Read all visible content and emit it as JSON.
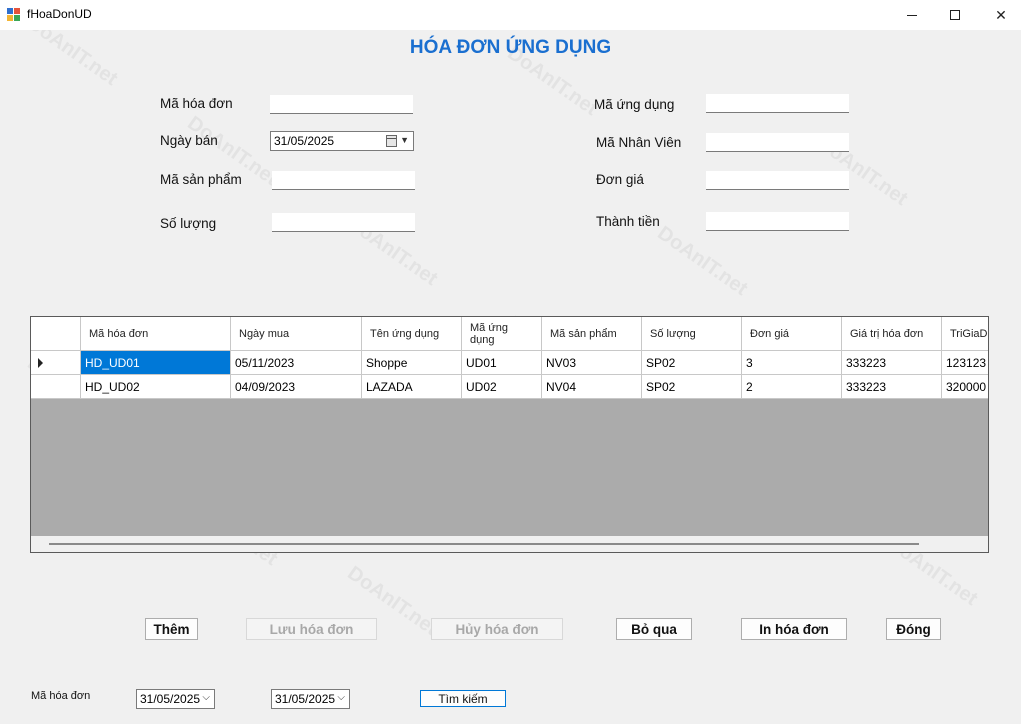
{
  "window": {
    "title": "fHoaDonUD"
  },
  "form": {
    "title": "HÓA ĐƠN ỨNG DỤNG",
    "fields": {
      "ma_hoa_don": {
        "label": "Mã hóa đơn",
        "value": ""
      },
      "ngay_ban": {
        "label": "Ngày bán",
        "value": "31/05/2025"
      },
      "ma_san_pham": {
        "label": "Mã sản phẩm",
        "value": ""
      },
      "so_luong": {
        "label": "Số lượng",
        "value": ""
      },
      "ma_ung_dung": {
        "label": "Mã ứng dụng",
        "value": ""
      },
      "ma_nhan_vien": {
        "label": "Mã Nhân Viên",
        "value": ""
      },
      "don_gia": {
        "label": "Đơn giá",
        "value": ""
      },
      "thanh_tien": {
        "label": "Thành tiền",
        "value": ""
      }
    }
  },
  "grid": {
    "columns": [
      "Mã hóa đơn",
      "Ngày mua",
      "Tên ứng dụng",
      "Mã ứng dụng",
      "Mã sản phẩm",
      "Số lượng",
      "Đơn giá",
      "Giá trị hóa đơn",
      "TriGiaDH"
    ],
    "rows": [
      [
        "HD_UD01",
        "05/11/2023",
        "Shoppe",
        "UD01",
        "NV03",
        "SP02",
        "3",
        "333223",
        "123123"
      ],
      [
        "HD_UD02",
        "04/09/2023",
        "LAZADA",
        "UD02",
        "NV04",
        "SP02",
        "2",
        "333223",
        "320000"
      ]
    ],
    "selected_row": 0
  },
  "buttons": {
    "them": "Thêm",
    "luu_hoa_don": "Lưu hóa đơn",
    "huy_hoa_don": "Hủy hóa đơn",
    "bo_qua": "Bỏ qua",
    "in_hoa_don": "In hóa đơn",
    "dong": "Đóng"
  },
  "search": {
    "label": "Mã hóa đơn",
    "from_date": "31/05/2025",
    "to_date": "31/05/2025",
    "button": "Tìm kiếm"
  },
  "watermark": {
    "text": "DoAnIT.net"
  },
  "colors": {
    "title_blue": "#1a6fd0",
    "selection": "#0078d7",
    "grid_empty": "#ababab"
  }
}
